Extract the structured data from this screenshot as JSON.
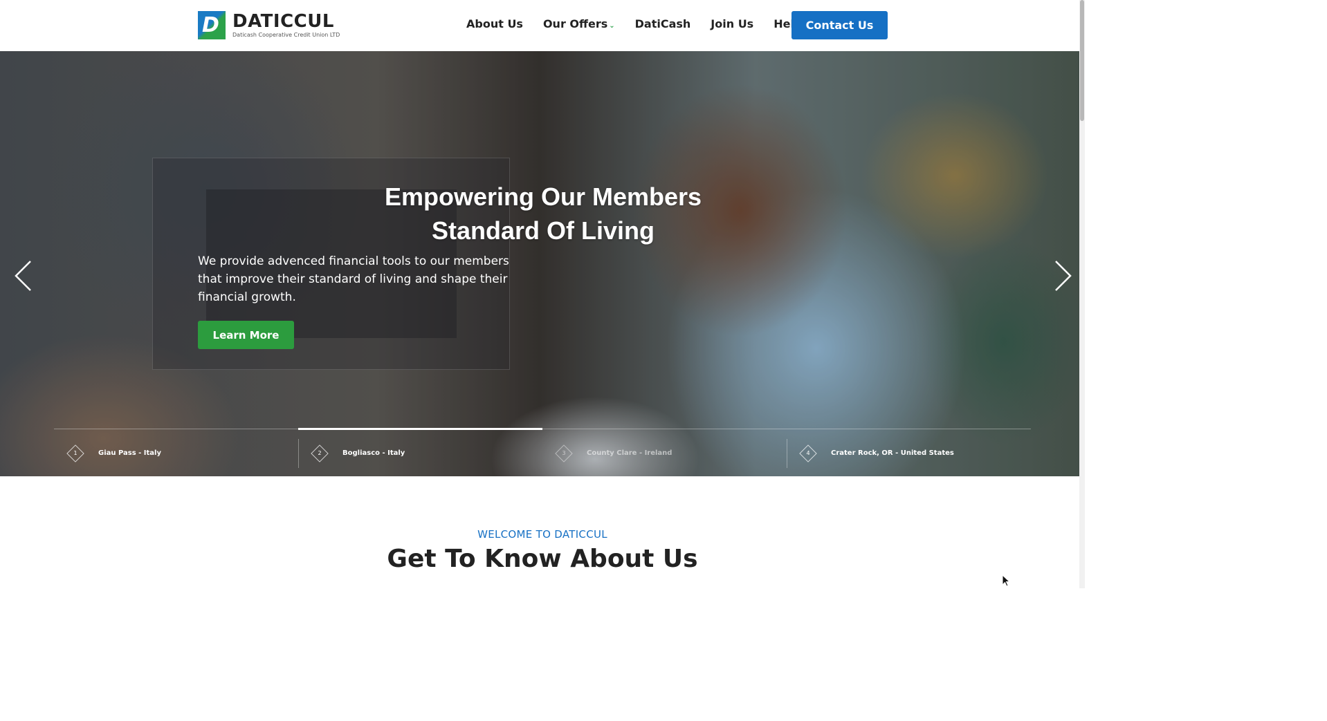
{
  "brand": {
    "name": "DATICCUL",
    "tagline": "Daticash Cooperative Credit Union LTD",
    "logo_letter": "D",
    "primary_color": "#1670c4",
    "accent_color": "#2c9c3e"
  },
  "nav": {
    "items": [
      {
        "label": "About Us"
      },
      {
        "label": "Our Offers",
        "has_dropdown": true
      },
      {
        "label": "DatiCash"
      },
      {
        "label": "Join Us"
      },
      {
        "label": "Help"
      }
    ],
    "cta_label": "Contact Us"
  },
  "hero": {
    "title_line1": "Empowering Our Members",
    "title_line2": "Standard Of Living",
    "description": "We provide advenced financial tools to our members that improve their standard of living and shape their financial growth.",
    "button_label": "Learn More",
    "prev_icon": "chevron-left-icon",
    "next_icon": "chevron-right-icon",
    "slides": [
      {
        "number": "1",
        "label": "Giau Pass - Italy"
      },
      {
        "number": "2",
        "label": "Bogliasco - Italy"
      },
      {
        "number": "3",
        "label": "County Clare - Ireland"
      },
      {
        "number": "4",
        "label": "Crater Rock, OR - United States"
      }
    ],
    "active_slide": 2
  },
  "welcome": {
    "kicker": "WELCOME TO DATICCUL",
    "title": "Get To Know About Us"
  }
}
